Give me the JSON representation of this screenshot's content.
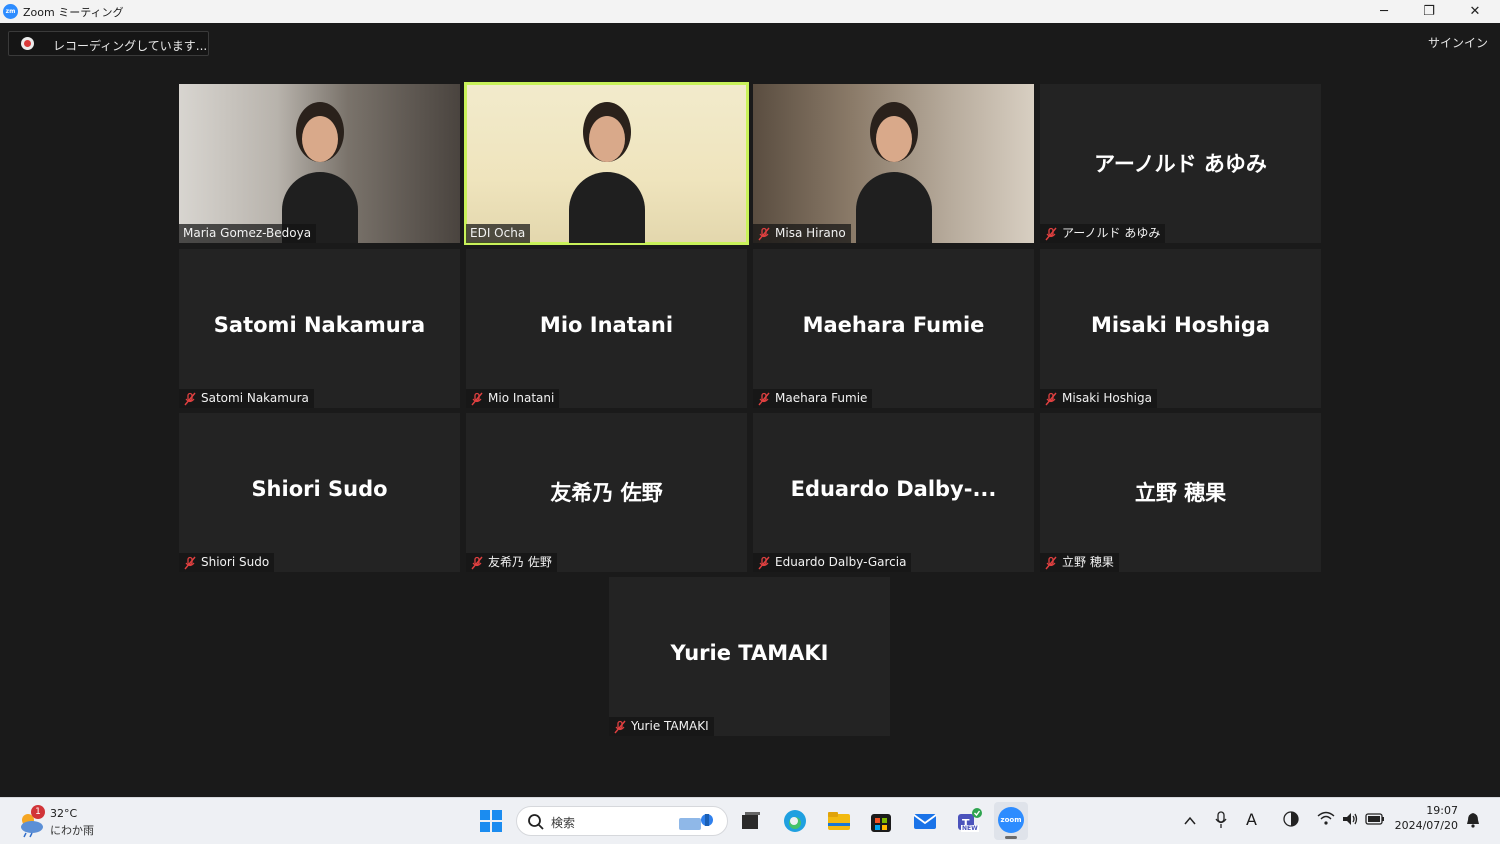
{
  "window": {
    "title": "Zoom ミーティング",
    "logo_text": "zm",
    "controls": {
      "minimize": "─",
      "restore": "❐",
      "close": "✕"
    }
  },
  "meeting": {
    "recording_label": "レコーディングしています...",
    "signin_label": "サインイン",
    "active_speaker_color": "#c9f25a",
    "participants": [
      {
        "label": "Maria Gomez-Bedoya",
        "display_name": "",
        "video": true,
        "muted": false,
        "active": false
      },
      {
        "label": "EDI Ocha",
        "display_name": "",
        "video": true,
        "muted": false,
        "active": true
      },
      {
        "label": "Misa Hirano",
        "display_name": "",
        "video": true,
        "muted": true,
        "active": false
      },
      {
        "label": "アーノルド あゆみ",
        "display_name": "アーノルド あゆみ",
        "video": false,
        "muted": true,
        "active": false
      },
      {
        "label": "Satomi Nakamura",
        "display_name": "Satomi Nakamura",
        "video": false,
        "muted": true,
        "active": false
      },
      {
        "label": "Mio Inatani",
        "display_name": "Mio Inatani",
        "video": false,
        "muted": true,
        "active": false
      },
      {
        "label": "Maehara Fumie",
        "display_name": "Maehara Fumie",
        "video": false,
        "muted": true,
        "active": false
      },
      {
        "label": "Misaki Hoshiga",
        "display_name": "Misaki Hoshiga",
        "video": false,
        "muted": true,
        "active": false
      },
      {
        "label": "Shiori Sudo",
        "display_name": "Shiori Sudo",
        "video": false,
        "muted": true,
        "active": false
      },
      {
        "label": "友希乃 佐野",
        "display_name": "友希乃 佐野",
        "video": false,
        "muted": true,
        "active": false
      },
      {
        "label": "Eduardo Dalby-Garcia",
        "display_name": "Eduardo  Dalby-...",
        "video": false,
        "muted": true,
        "active": false
      },
      {
        "label": "立野 穂果",
        "display_name": "立野 穂果",
        "video": false,
        "muted": true,
        "active": false
      },
      {
        "label": "Yurie TAMAKI",
        "display_name": "Yurie TAMAKI",
        "video": false,
        "muted": true,
        "active": false
      }
    ]
  },
  "taskbar": {
    "weather": {
      "temp": "32°C",
      "condition": "にわか雨",
      "badge": "1",
      "icon": "weather-icon"
    },
    "search_label": "検索",
    "apps": [
      "start-icon",
      "task-view-icon",
      "edge-icon",
      "file-explorer-icon",
      "store-icon",
      "mail-icon",
      "teams-icon",
      "zoom-icon"
    ],
    "teams_badge": "NEW",
    "zoom_icon_text": "zoom",
    "tray": {
      "ime": "A",
      "time": "19:07",
      "date": "2024/07/20"
    }
  }
}
